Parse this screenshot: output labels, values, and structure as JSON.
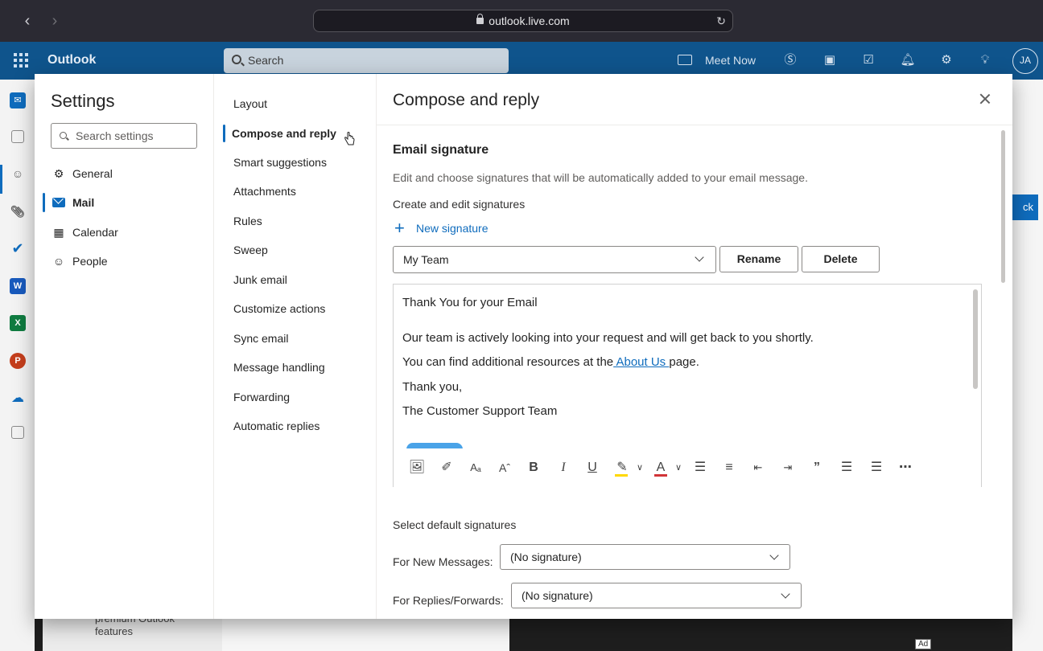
{
  "browser": {
    "url": "outlook.live.com"
  },
  "app_bar": {
    "app_name": "Outlook",
    "search_placeholder": "Search",
    "meet_now": "Meet Now",
    "avatar_initials": "JA"
  },
  "background": {
    "promo_line1": "premium Outlook",
    "promo_line2": "features",
    "ad_label": "Ad",
    "button_fragment": "ck"
  },
  "settings": {
    "title": "Settings",
    "search_placeholder": "Search settings",
    "categories": [
      {
        "label": "General",
        "icon": "gear-icon"
      },
      {
        "label": "Mail",
        "icon": "mail-icon"
      },
      {
        "label": "Calendar",
        "icon": "calendar-icon"
      },
      {
        "label": "People",
        "icon": "people-icon"
      }
    ],
    "mail_subcategories": [
      "Layout",
      "Compose and reply",
      "Smart suggestions",
      "Attachments",
      "Rules",
      "Sweep",
      "Junk email",
      "Customize actions",
      "Sync email",
      "Message handling",
      "Forwarding",
      "Automatic replies"
    ],
    "selected_category": "Mail",
    "selected_subcategory": "Compose and reply"
  },
  "pane": {
    "title": "Compose and reply",
    "section_title": "Email signature",
    "section_desc": "Edit and choose signatures that will be automatically added to your email message.",
    "create_edit_label": "Create and edit signatures",
    "new_signature": "New signature",
    "signature_selected": "My Team",
    "rename_label": "Rename",
    "delete_label": "Delete",
    "editor": {
      "line1": "Thank You for your Email",
      "line2": "Our team is actively looking into your request and will get back to you shortly.",
      "line3_before": "You can find additional resources at the",
      "line3_link": " About Us ",
      "line3_after": "page.",
      "line4": "Thank you,",
      "line5": "The Customer Support Team"
    },
    "toolbar_icons": [
      "image-icon",
      "format-painter-icon",
      "font-size-icon",
      "font-grow-icon",
      "bold-icon",
      "italic-icon",
      "underline-icon",
      "highlight-icon",
      "font-color-icon",
      "bullets-icon",
      "numbering-icon",
      "outdent-icon",
      "indent-icon",
      "quote-icon",
      "align-left-icon",
      "align-center-icon",
      "more-icon"
    ],
    "defaults_title": "Select default signatures",
    "new_messages_label": "For New Messages:",
    "new_messages_value": "(No signature)",
    "replies_label": "For Replies/Forwards:",
    "replies_value": "(No signature)",
    "colors": {
      "accent": "#0f6cbd",
      "app_bar": "#0f548c",
      "highlight": "#ffd800",
      "font_color": "#d13438"
    }
  }
}
